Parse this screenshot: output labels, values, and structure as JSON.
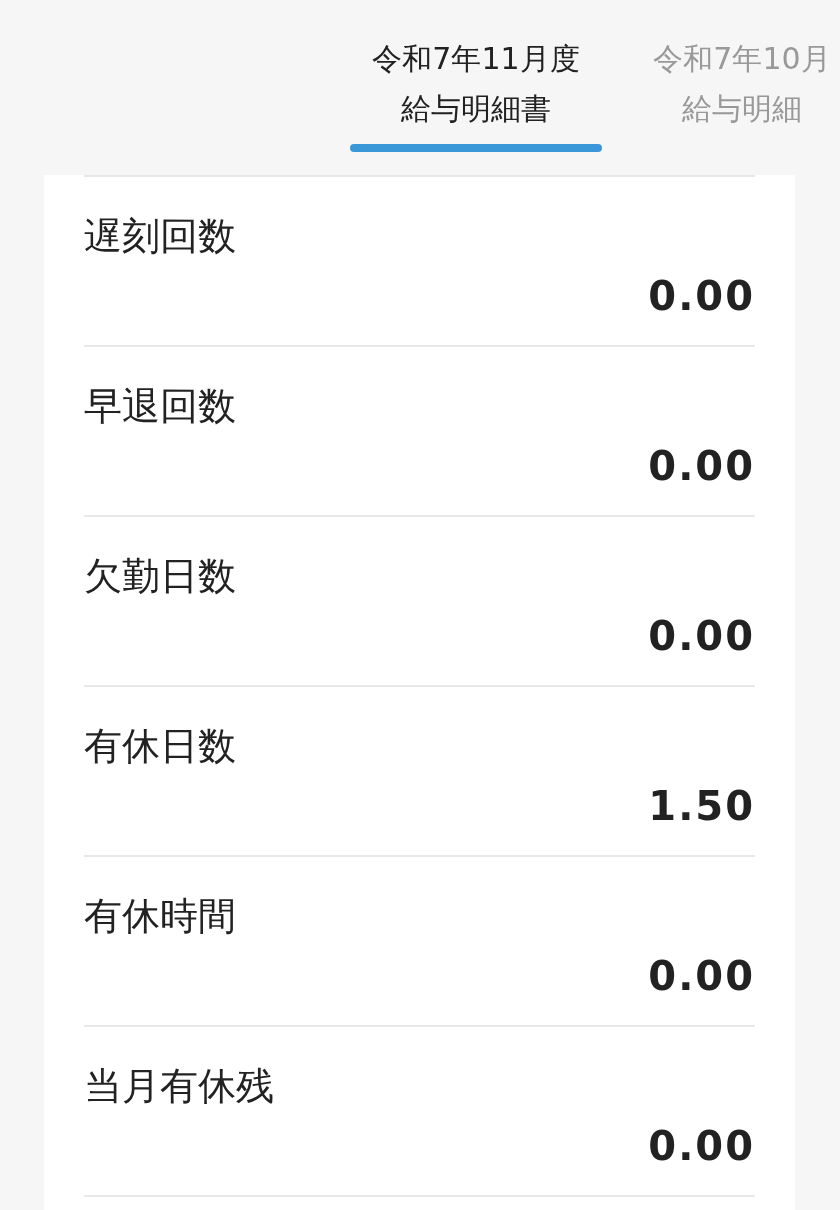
{
  "tabs": [
    {
      "line1": "令和7年11月度",
      "line2": "給与明細書",
      "selected": true
    },
    {
      "line1": "令和7年10月",
      "line2": "給与明細",
      "selected": false
    }
  ],
  "rows": [
    {
      "label": "遅刻回数",
      "value": "0.00"
    },
    {
      "label": "早退回数",
      "value": "0.00"
    },
    {
      "label": "欠勤日数",
      "value": "0.00"
    },
    {
      "label": "有休日数",
      "value": "1.50"
    },
    {
      "label": "有休時間",
      "value": "0.00"
    },
    {
      "label": "当月有休残",
      "value": "0.00"
    }
  ]
}
